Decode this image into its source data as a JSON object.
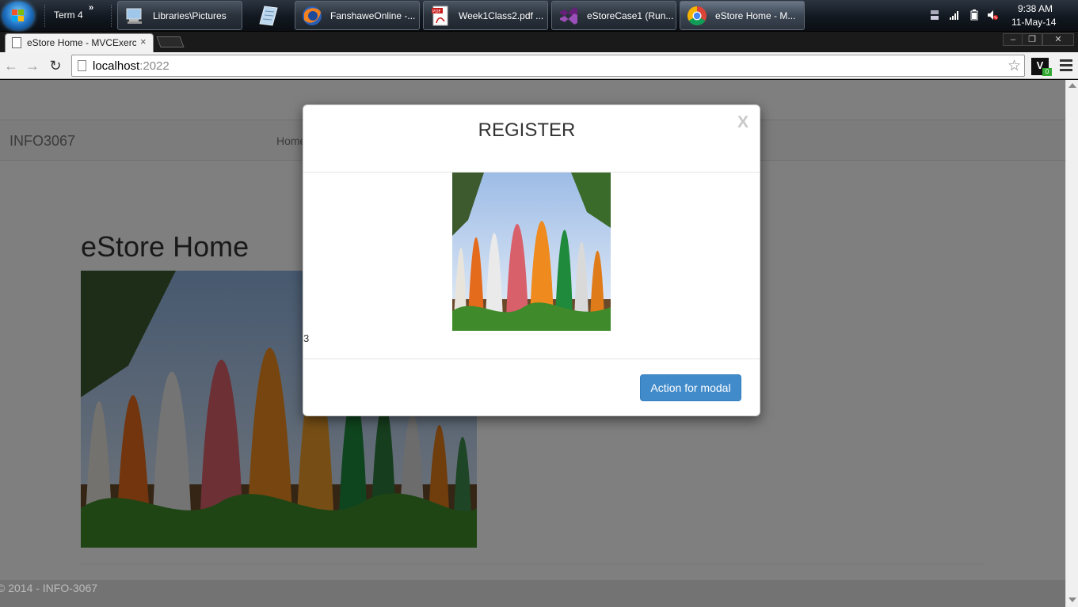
{
  "taskbar": {
    "term_label": "Term 4",
    "more_label": "»",
    "buttons": [
      {
        "label": "Libraries\\Pictures",
        "icon": "computer-icon"
      },
      {
        "label": "FanshaweOnline -...",
        "icon": "firefox-icon"
      },
      {
        "label": "Week1Class2.pdf ...",
        "icon": "pdf-icon"
      },
      {
        "label": "eStoreCase1 (Run...",
        "icon": "visual-studio-icon"
      },
      {
        "label": "eStore Home - M...",
        "icon": "chrome-icon"
      }
    ],
    "clock_time": "9:38 AM",
    "clock_date": "11-May-14"
  },
  "browser": {
    "tab_title": "eStore Home - MVCExerci",
    "tab_close": "×",
    "url_host": "localhost",
    "url_port": ":2022",
    "window_min": "–",
    "window_restore": "❐",
    "window_close": "✕",
    "back_glyph": "←",
    "forward_glyph": "→",
    "reload_glyph": "↻",
    "star_glyph": "☆",
    "ext_glyph": "V",
    "ext_badge": "0"
  },
  "page": {
    "brand": "INFO3067",
    "nav_home": "Home",
    "heading": "eStore Home",
    "footer": "© 2014 - INFO-3067"
  },
  "modal": {
    "title": "REGISTER",
    "close_label": "X",
    "count": "3",
    "action_label": "Action for modal"
  },
  "colors": {
    "primary_button": "#428bca",
    "backdrop": "rgba(0,0,0,0.5)"
  }
}
